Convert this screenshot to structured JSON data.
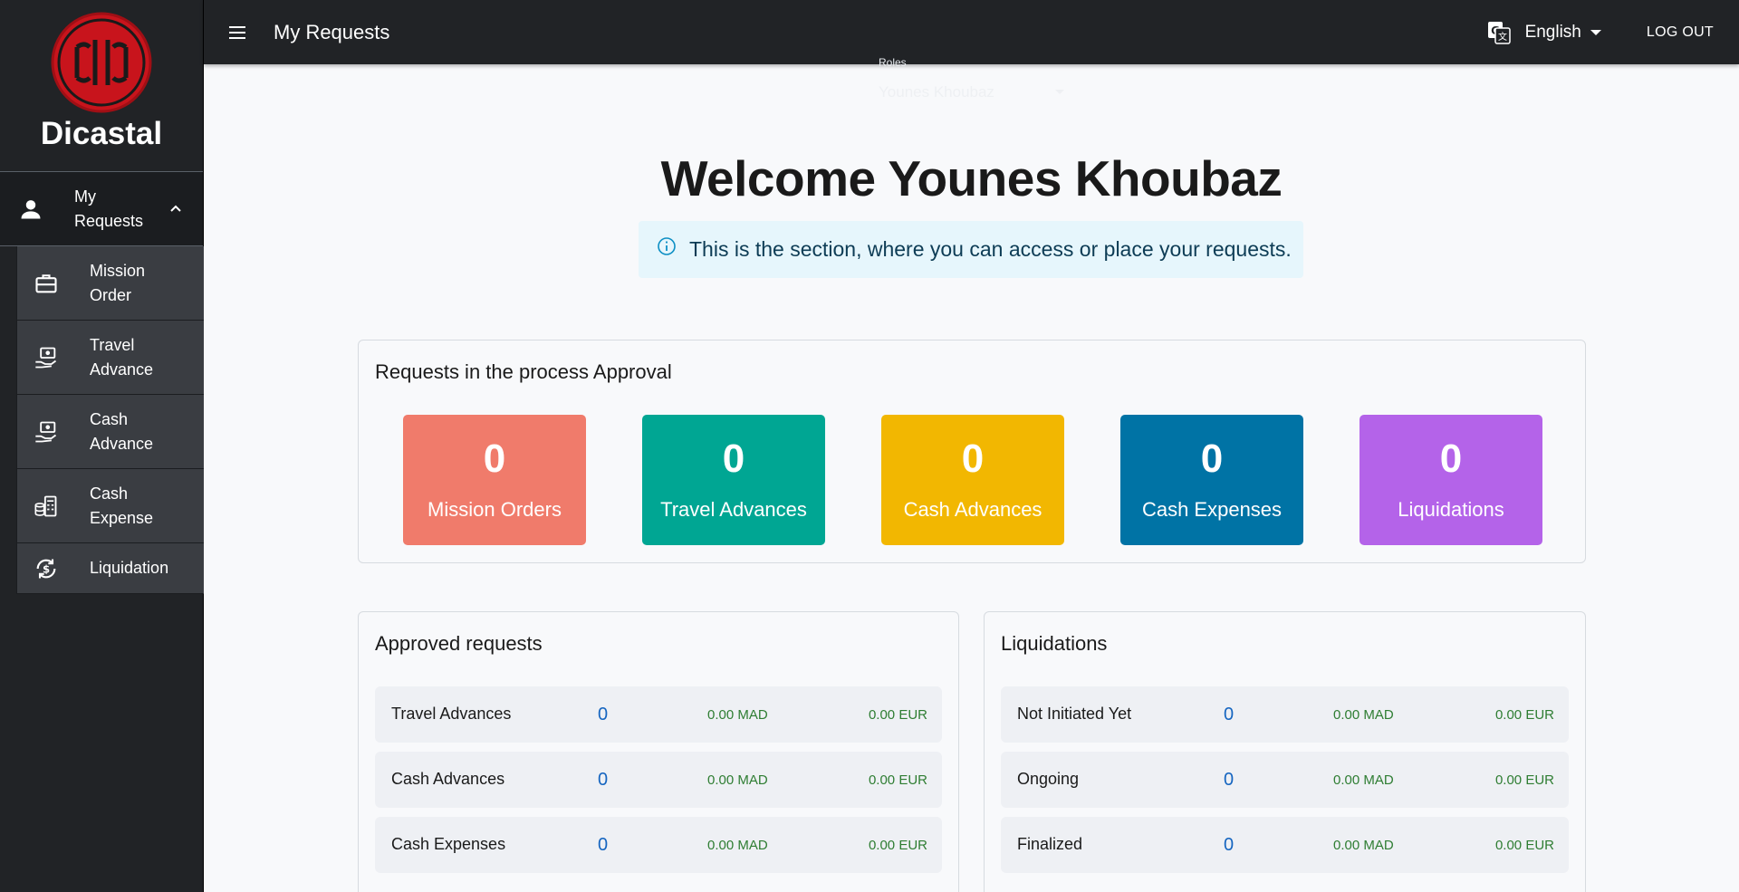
{
  "sidebar": {
    "brand_name": "Dicastal",
    "parent_label": "My Requests",
    "items": [
      {
        "label": "Mission Order"
      },
      {
        "label": "Travel Advance"
      },
      {
        "label": "Cash Advance"
      },
      {
        "label": "Cash Expense"
      },
      {
        "label": "Liquidation"
      }
    ]
  },
  "topbar": {
    "title": "My Requests",
    "language": "English",
    "logout": "LOG OUT"
  },
  "ghost": {
    "roles_label": "Roles",
    "user": "Younes Khoubaz"
  },
  "welcome": "Welcome Younes Khoubaz",
  "info_text": "This is the section, where you can access or place your requests.",
  "process": {
    "title": "Requests in the process Approval",
    "tiles": [
      {
        "count": "0",
        "label": "Mission Orders",
        "color": "#f07b6b"
      },
      {
        "count": "0",
        "label": "Travel Advances",
        "color": "#00a693"
      },
      {
        "count": "0",
        "label": "Cash Advances",
        "color": "#f2b701"
      },
      {
        "count": "0",
        "label": "Cash Expenses",
        "color": "#0073a5"
      },
      {
        "count": "0",
        "label": "Liquidations",
        "color": "#b463e9"
      }
    ]
  },
  "approved": {
    "title": "Approved requests",
    "rows": [
      {
        "label": "Travel Advances",
        "count": "0",
        "mad": "0.00 MAD",
        "eur": "0.00 EUR"
      },
      {
        "label": "Cash Advances",
        "count": "0",
        "mad": "0.00 MAD",
        "eur": "0.00 EUR"
      },
      {
        "label": "Cash Expenses",
        "count": "0",
        "mad": "0.00 MAD",
        "eur": "0.00 EUR"
      }
    ]
  },
  "liquidations": {
    "title": "Liquidations",
    "rows": [
      {
        "label": "Not Initiated Yet",
        "count": "0",
        "mad": "0.00 MAD",
        "eur": "0.00 EUR"
      },
      {
        "label": "Ongoing",
        "count": "0",
        "mad": "0.00 MAD",
        "eur": "0.00 EUR"
      },
      {
        "label": "Finalized",
        "count": "0",
        "mad": "0.00 MAD",
        "eur": "0.00 EUR"
      }
    ]
  }
}
